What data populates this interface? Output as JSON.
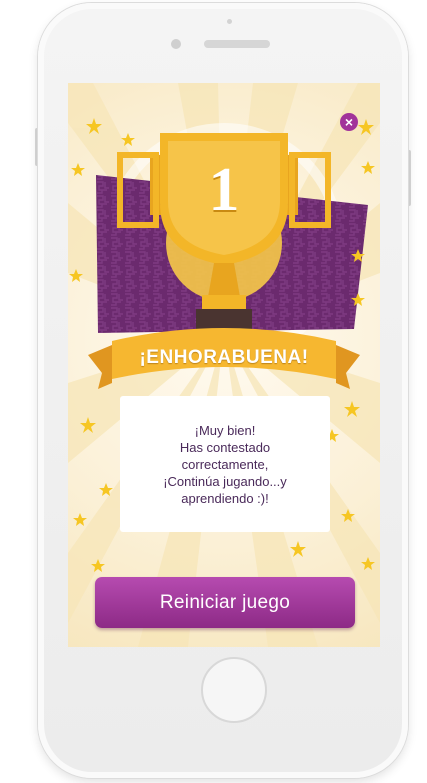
{
  "device": {
    "model": "phone-mockup"
  },
  "trophy": {
    "place": "1"
  },
  "banner": {
    "title": "¡ENHORABUENA!"
  },
  "message": {
    "lines": [
      "¡Muy bien!",
      "Has contestado",
      "correctamente,",
      "¡Continúa jugando...y",
      "aprendiendo :)!"
    ]
  },
  "actions": {
    "close_icon": "×",
    "restart_label": "Reiniciar juego"
  },
  "colors": {
    "accent": "#a1339a",
    "button_top": "#b64bb0",
    "button_bottom": "#8d2a86",
    "banner": "#f6b730",
    "trophy_gold": "#f3b628",
    "panel_purple": "#6b2a6e",
    "text": "#4a2a5a"
  }
}
